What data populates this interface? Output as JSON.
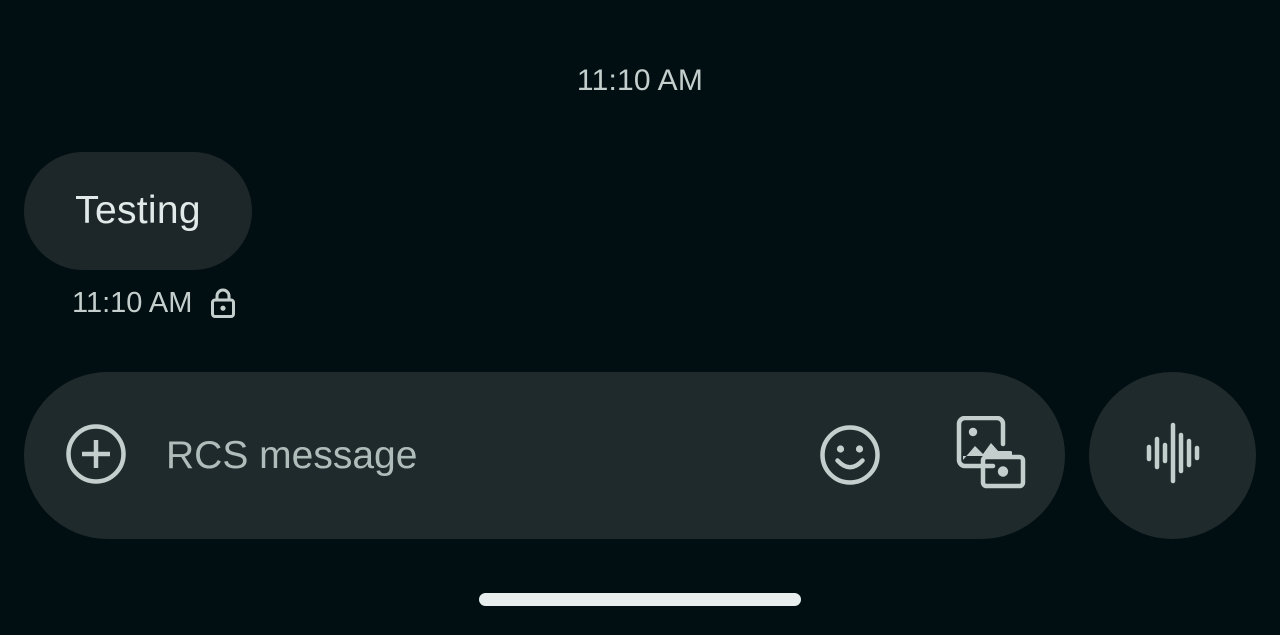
{
  "conversation": {
    "header_timestamp": "11:10 AM",
    "messages": [
      {
        "text": "Testing",
        "timestamp": "11:10 AM",
        "status_icon": "lock-icon"
      }
    ]
  },
  "composer": {
    "placeholder": "RCS message",
    "value": "",
    "add_icon": "plus-circle-icon",
    "emoji_icon": "smiley-face-icon",
    "media_icon": "gallery-camera-icon",
    "voice_icon": "waveform-icon"
  },
  "colors": {
    "background": "#020f12",
    "bubble": "#1d2729",
    "composer": "#1f2a2c",
    "text_primary": "#e2eae9",
    "text_secondary": "#c4cfcd",
    "icon": "#c4cfcd"
  }
}
